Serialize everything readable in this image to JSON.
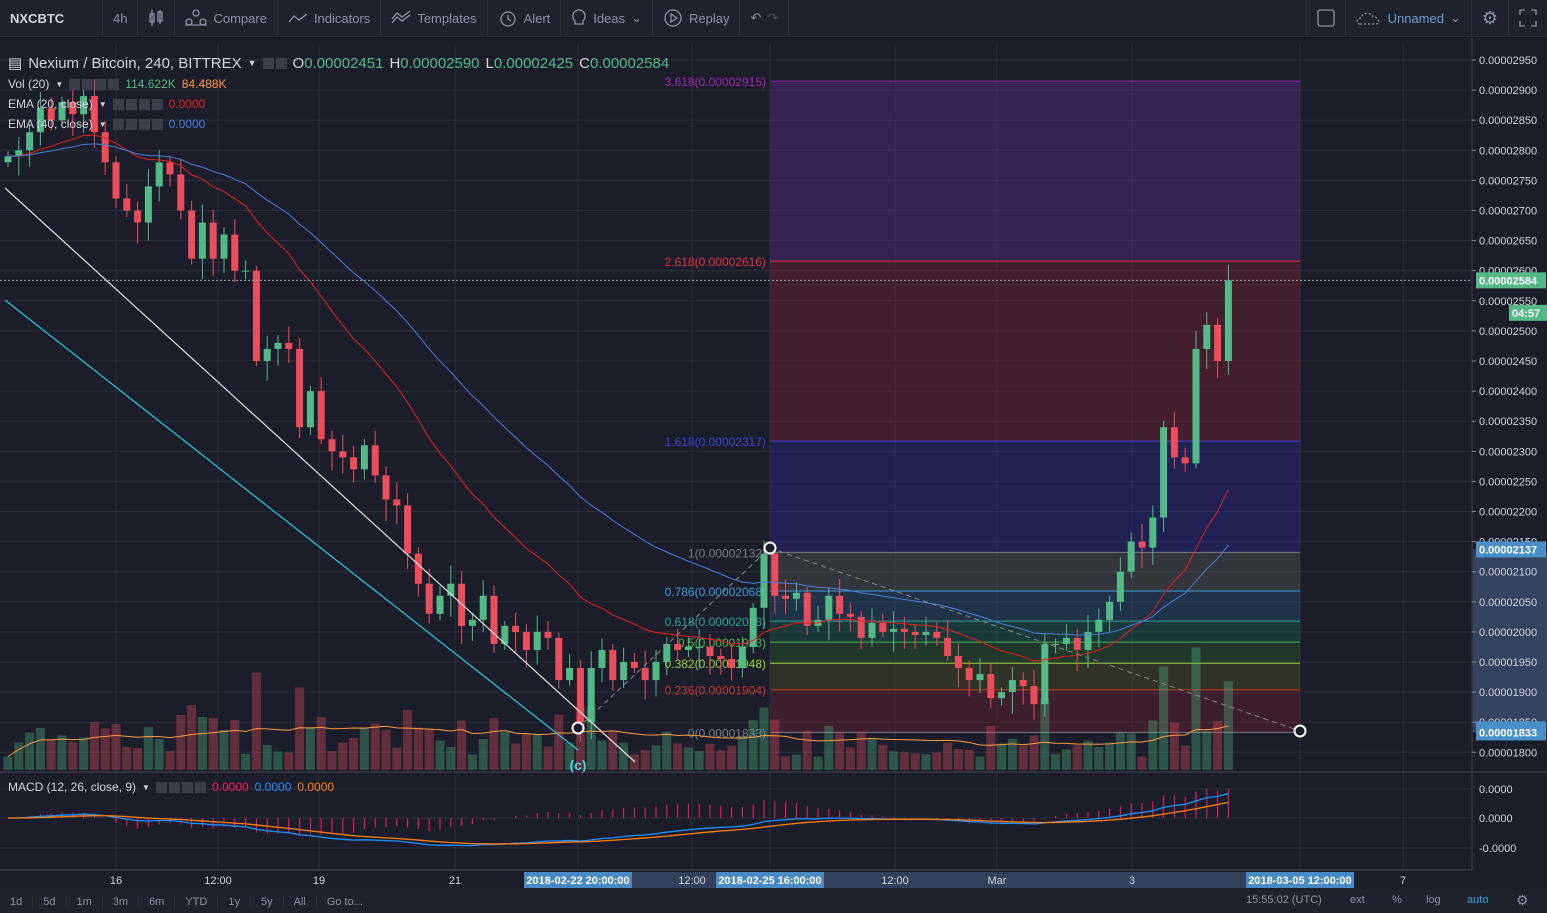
{
  "toolbar": {
    "symbol": "NXCBTC",
    "interval": "4h",
    "compare": "Compare",
    "indicators": "Indicators",
    "templates": "Templates",
    "alert": "Alert",
    "ideas": "Ideas",
    "replay": "Replay",
    "layout_name": "Unnamed"
  },
  "legend": {
    "title": "Nexium / Bitcoin, 240, BITTREX",
    "o_label": "O",
    "o": "0.00002451",
    "h_label": "H",
    "h": "0.00002590",
    "l_label": "L",
    "l": "0.00002425",
    "c_label": "C",
    "c": "0.00002584",
    "vol": {
      "name": "Vol (20)",
      "v1": "114.622K",
      "v2": "84.488K"
    },
    "ema20": {
      "name": "EMA (20, close)",
      "value": "0.0000"
    },
    "ema40": {
      "name": "EMA (40, close)",
      "value": "0.0000"
    },
    "macd": {
      "name": "MACD (12, 26, close, 9)",
      "v1": "0.0000",
      "v2": "0.0000",
      "v3": "0.0000"
    }
  },
  "colors": {
    "up": "#53b987",
    "down": "#eb4d5c",
    "ema20": "#e02020",
    "ema40": "#4a7cd6",
    "macd": "#1e90ff",
    "signal": "#ff7f0e",
    "hist": "#ff1a6a",
    "vol_ma": "#ff9a3c",
    "accent": "#4a90c8"
  },
  "candles_close": [
    2790,
    2800,
    2830,
    2870,
    2850,
    2880,
    2860,
    2890,
    2830,
    2780,
    2720,
    2700,
    2680,
    2740,
    2780,
    2760,
    2700,
    2620,
    2680,
    2620,
    2660,
    2600,
    2600,
    2450,
    2470,
    2480,
    2470,
    2340,
    2400,
    2320,
    2300,
    2290,
    2270,
    2310,
    2260,
    2220,
    2210,
    2130,
    2080,
    2030,
    2060,
    2080,
    2010,
    2020,
    2060,
    1980,
    2010,
    2000,
    1970,
    2000,
    1990,
    1920,
    1940,
    1850,
    1940,
    1970,
    1920,
    1950,
    1940,
    1920,
    1950,
    1980,
    1970,
    1975,
    1975,
    1960,
    1955,
    1940,
    1975,
    2040,
    2130,
    2060,
    2055,
    2065,
    2010,
    2020,
    2060,
    2030,
    2025,
    1990,
    2015,
    2000,
    2005,
    2000,
    1995,
    2000,
    1990,
    1960,
    1940,
    1920,
    1930,
    1890,
    1900,
    1920,
    1910,
    1880,
    1980,
    1980,
    1990,
    1970,
    2000,
    2020,
    2050,
    2100,
    2150,
    2140,
    2190,
    2340,
    2290,
    2280,
    2470,
    2510,
    2450,
    2584
  ],
  "fib": [
    {
      "ratio": "0",
      "label": "0(0.00001833)",
      "price": 1833,
      "color": "#787b86",
      "fill": "#7a2030"
    },
    {
      "ratio": "0.236",
      "label": "0.236(0.00001904)",
      "price": 1904,
      "color": "#c0392b",
      "fill": "#5a5a20"
    },
    {
      "ratio": "0.382",
      "label": "0.382(0.00001948)",
      "price": 1948,
      "color": "#9acd32",
      "fill": "#2a6a2a"
    },
    {
      "ratio": "0.5",
      "label": "0.5(0.00001983)",
      "price": 1983,
      "color": "#4caf50",
      "fill": "#1a6a5a"
    },
    {
      "ratio": "0.618",
      "label": "0.618(0.00002018)",
      "price": 2018,
      "color": "#26a69a",
      "fill": "#2a5a80"
    },
    {
      "ratio": "0.786",
      "label": "0.786(0.00002068)",
      "price": 2068,
      "color": "#3d9bd4",
      "fill": "#606060"
    },
    {
      "ratio": "1",
      "label": "1(0.00002132)",
      "price": 2132,
      "color": "#787b86",
      "fill": "#2a2aa0"
    },
    {
      "ratio": "1.618",
      "label": "1.618(0.00002317)",
      "price": 2317,
      "color": "#3f3fd0",
      "fill": "#902030"
    },
    {
      "ratio": "2.618",
      "label": "2.618(0.00002616)",
      "price": 2616,
      "color": "#e03040",
      "fill": "#6a2aa0"
    },
    {
      "ratio": "3.618",
      "label": "3.618(0.00002915)",
      "price": 2915,
      "color": "#9c27b0",
      "fill": null
    }
  ],
  "wave_label": "(c)",
  "price_axis": [
    "0.00002950",
    "0.00002900",
    "0.00002850",
    "0.00002800",
    "0.00002750",
    "0.00002700",
    "0.00002650",
    "0.00002600",
    "0.00002550",
    "0.00002500",
    "0.00002450",
    "0.00002400",
    "0.00002350",
    "0.00002300",
    "0.00002250",
    "0.00002200",
    "0.00002150",
    "0.00002100",
    "0.00002050",
    "0.00002000",
    "0.00001950",
    "0.00001900",
    "0.00001850",
    "0.00001800"
  ],
  "price_tags": [
    {
      "text": "0.00002584",
      "price": 2584,
      "color": "#53b987"
    },
    {
      "text": "04:57",
      "price": 2530,
      "color": "#53b987"
    },
    {
      "text": "0.00002137",
      "price": 2137,
      "color": "#4a90c8"
    },
    {
      "text": "0.00001838",
      "price": 1838,
      "color": "#4a90c8"
    },
    {
      "text": "0.00001833",
      "price": 1833,
      "color": "#4a90c8"
    }
  ],
  "macd_axis": [
    "0.0000",
    "0.0000",
    "-0.0000"
  ],
  "time_axis": [
    {
      "t": "16",
      "hl": false
    },
    {
      "t": "12:00",
      "hl": false
    },
    {
      "t": "19",
      "hl": false
    },
    {
      "t": "21",
      "hl": false
    },
    {
      "t": "2018-02-22 20:00:00",
      "hl": true
    },
    {
      "t": "12:00",
      "hl": false
    },
    {
      "t": "2018-02-25 16:00:00",
      "hl": true
    },
    {
      "t": "12:00",
      "hl": false
    },
    {
      "t": "Mar",
      "hl": false
    },
    {
      "t": "3",
      "hl": false
    },
    {
      "t": "2018-03-05 12:00:00",
      "hl": true
    },
    {
      "t": "7",
      "hl": false
    }
  ],
  "bottom": {
    "ranges": [
      "1d",
      "5d",
      "1m",
      "3m",
      "6m",
      "YTD",
      "1y",
      "5y",
      "All"
    ],
    "goto": "Go to...",
    "clock": "15:55:02 (UTC)",
    "ext": "ext",
    "pct": "%",
    "log": "log",
    "auto": "auto"
  }
}
